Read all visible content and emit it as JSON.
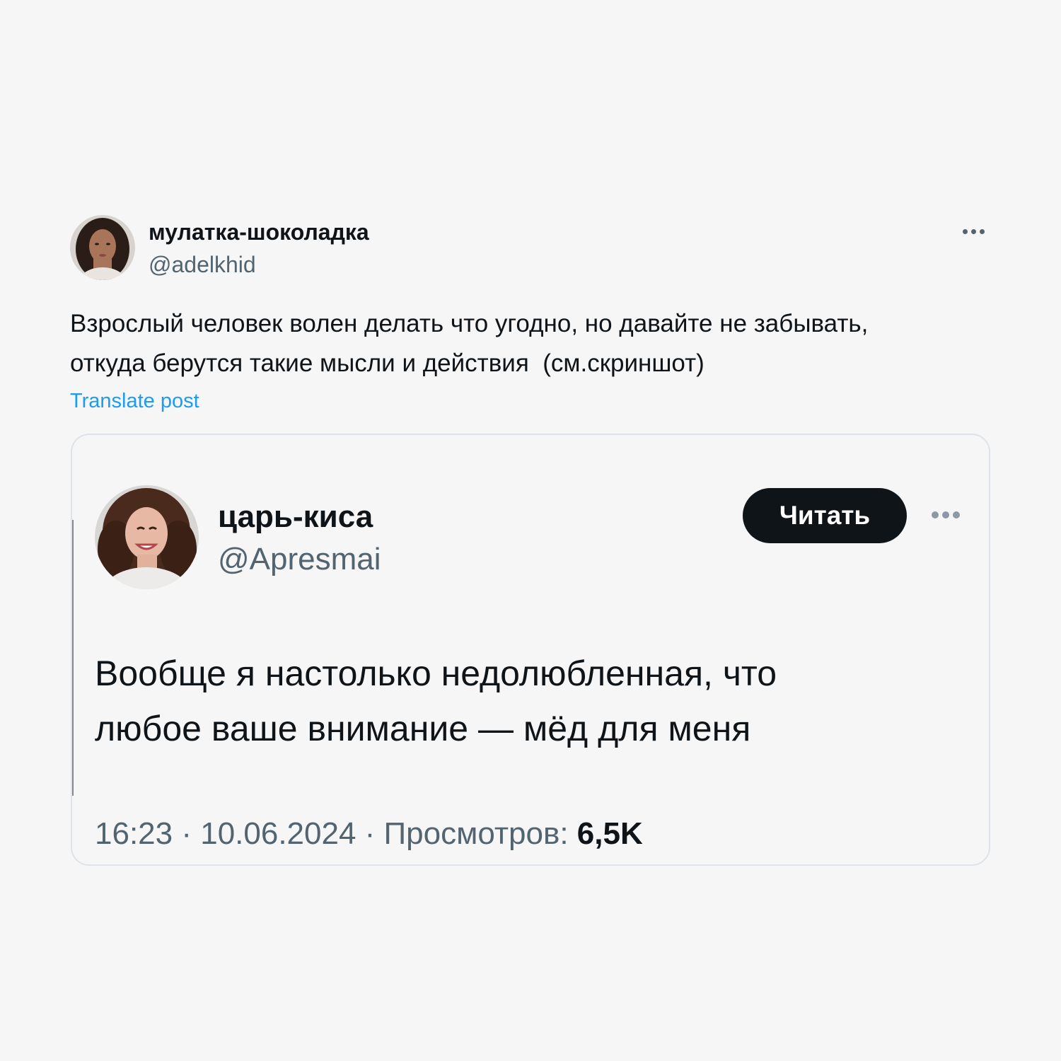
{
  "post": {
    "author": {
      "display_name": "мулатка-шоколадка",
      "handle": "@adelkhid"
    },
    "more_icon": "more-horizontal-icon",
    "text": "Взрослый человек волен делать что угодно, но давайте не забывать,\nоткуда берутся такие мысли и действия  (см.скриншот)",
    "translate_label": "Translate post",
    "link_color": "#1d9bf0"
  },
  "embedded": {
    "author": {
      "display_name": "царь-киса",
      "handle": "@Apresmai"
    },
    "follow_label": "Читать",
    "more_icon": "more-horizontal-icon",
    "text": "Вообще я настолько недолюбленная, что\nлюбое ваше внимание — мёд для меня",
    "time": "16:23",
    "separator_1": " · ",
    "date": "10.06.2024",
    "separator_2": " · ",
    "views_label": "Просмотров: ",
    "views_count": "6,5K"
  }
}
